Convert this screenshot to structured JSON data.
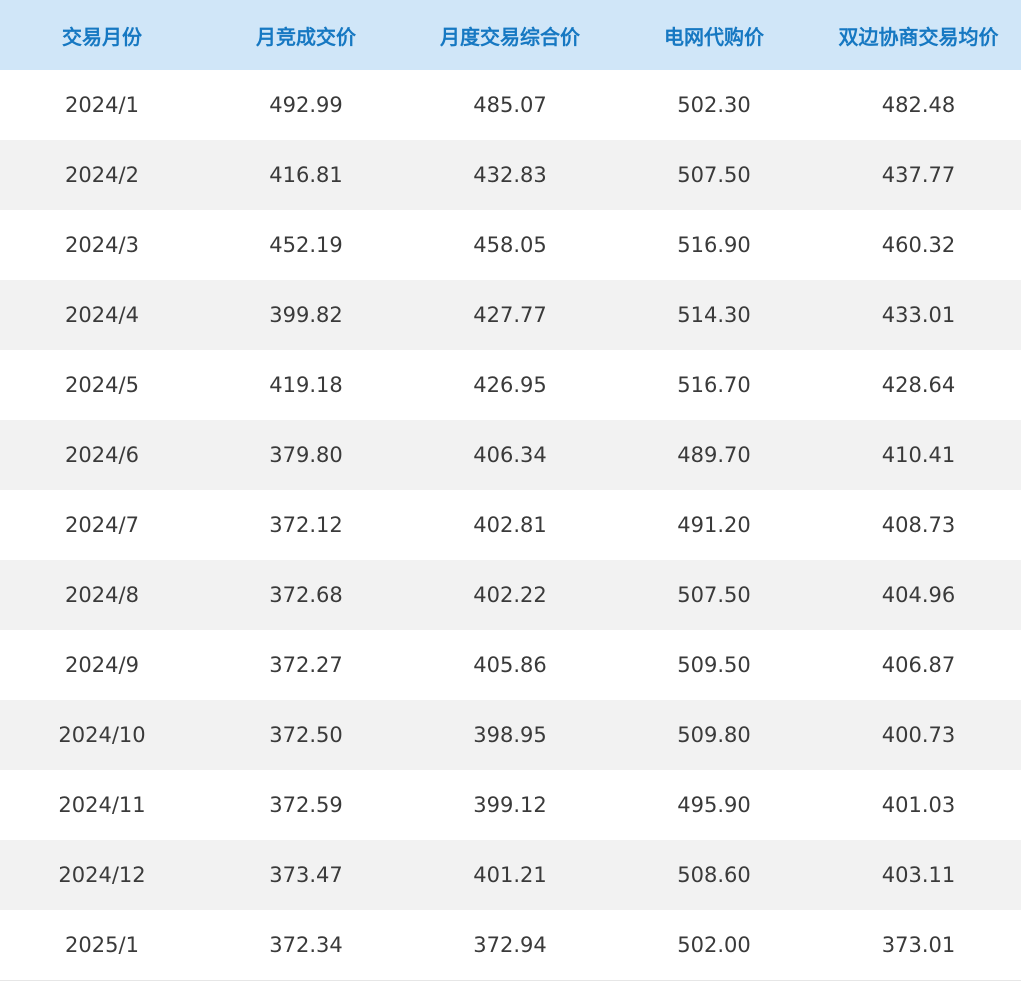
{
  "table": {
    "headers": [
      "交易月份",
      "月竞成交价",
      "月度交易综合价",
      "电网代购价",
      "双边协商交易均价"
    ],
    "rows": [
      [
        "2024/1",
        "492.99",
        "485.07",
        "502.30",
        "482.48"
      ],
      [
        "2024/2",
        "416.81",
        "432.83",
        "507.50",
        "437.77"
      ],
      [
        "2024/3",
        "452.19",
        "458.05",
        "516.90",
        "460.32"
      ],
      [
        "2024/4",
        "399.82",
        "427.77",
        "514.30",
        "433.01"
      ],
      [
        "2024/5",
        "419.18",
        "426.95",
        "516.70",
        "428.64"
      ],
      [
        "2024/6",
        "379.80",
        "406.34",
        "489.70",
        "410.41"
      ],
      [
        "2024/7",
        "372.12",
        "402.81",
        "491.20",
        "408.73"
      ],
      [
        "2024/8",
        "372.68",
        "402.22",
        "507.50",
        "404.96"
      ],
      [
        "2024/9",
        "372.27",
        "405.86",
        "509.50",
        "406.87"
      ],
      [
        "2024/10",
        "372.50",
        "398.95",
        "509.80",
        "400.73"
      ],
      [
        "2024/11",
        "372.59",
        "399.12",
        "495.90",
        "401.03"
      ],
      [
        "2024/12",
        "373.47",
        "401.21",
        "508.60",
        "403.11"
      ],
      [
        "2025/1",
        "372.34",
        "372.94",
        "502.00",
        "373.01"
      ]
    ]
  },
  "colors": {
    "header_background": "#d0e6f8",
    "header_text": "#1678c2",
    "row_alt_background": "#f2f2f2",
    "body_text": "#3a3a3a"
  }
}
